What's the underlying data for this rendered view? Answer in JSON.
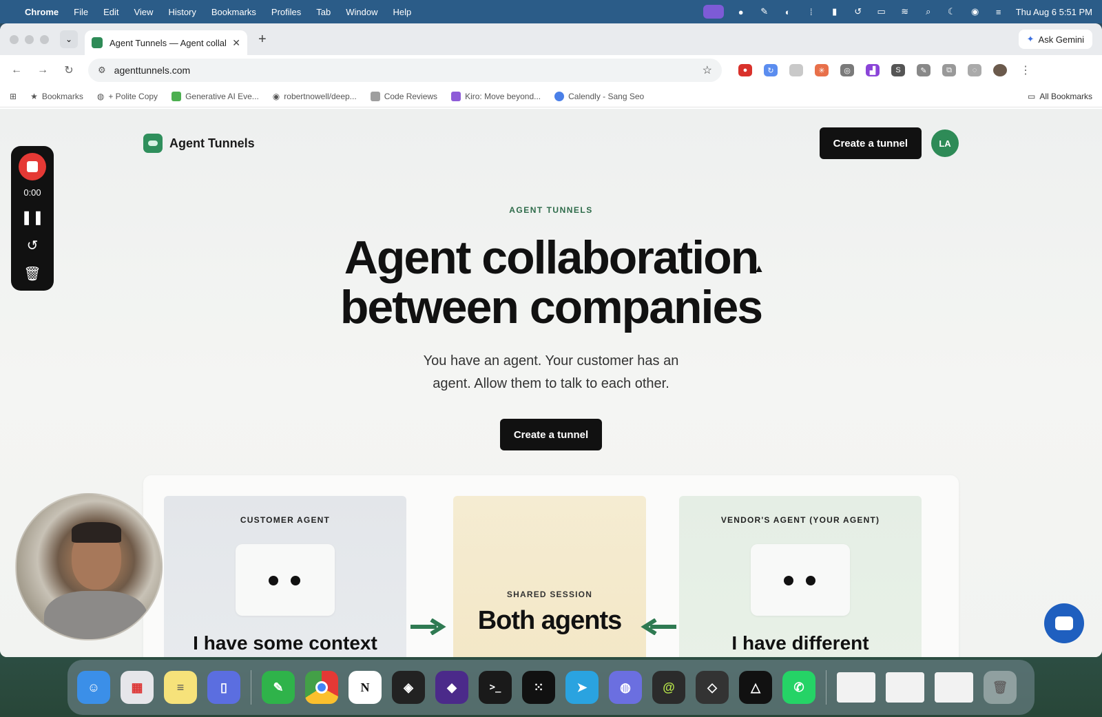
{
  "menubar": {
    "app": "Chrome",
    "items": [
      "File",
      "Edit",
      "View",
      "History",
      "Bookmarks",
      "Profiles",
      "Tab",
      "Window",
      "Help"
    ],
    "datetime": "Thu Aug 6  5:51 PM"
  },
  "browser": {
    "tab_title": "Agent Tunnels — Agent collal",
    "ask_gemini": "Ask Gemini",
    "url": "agenttunnels.com",
    "bookmarks": [
      {
        "label": "Bookmarks",
        "icon": "star-icon"
      },
      {
        "label": "+ Polite Copy",
        "icon": "globe-icon"
      },
      {
        "label": "Generative AI Eve...",
        "icon": "folder-icon"
      },
      {
        "label": "robertnowell/deep...",
        "icon": "github-icon"
      },
      {
        "label": "Code Reviews",
        "icon": "doc-icon"
      },
      {
        "label": "Kiro: Move beyond...",
        "icon": "kiro-icon"
      },
      {
        "label": "Calendly - Sang Seo",
        "icon": "calendly-icon"
      }
    ],
    "all_bookmarks": "All Bookmarks"
  },
  "site": {
    "brand": "Agent Tunnels",
    "header_cta": "Create a tunnel",
    "avatar_initials": "LA",
    "eyebrow": "AGENT TUNNELS",
    "headline_line1": "Agent collaboration",
    "headline_line2": "between companies",
    "subhead": "You have an agent. Your customer has an agent. Allow them to talk to each other.",
    "hero_cta": "Create a tunnel",
    "cards": {
      "customer_label": "CUSTOMER AGENT",
      "customer_title": "I have some context",
      "shared_label": "SHARED SESSION",
      "shared_title": "Both agents",
      "vendor_label": "VENDOR'S AGENT (YOUR AGENT)",
      "vendor_title": "I have different"
    }
  },
  "recorder": {
    "time": "0:00"
  },
  "colors": {
    "accent_green": "#2f8f5c",
    "dark_button": "#111111",
    "record_red": "#e53935",
    "chat_blue": "#1f5fbf"
  }
}
